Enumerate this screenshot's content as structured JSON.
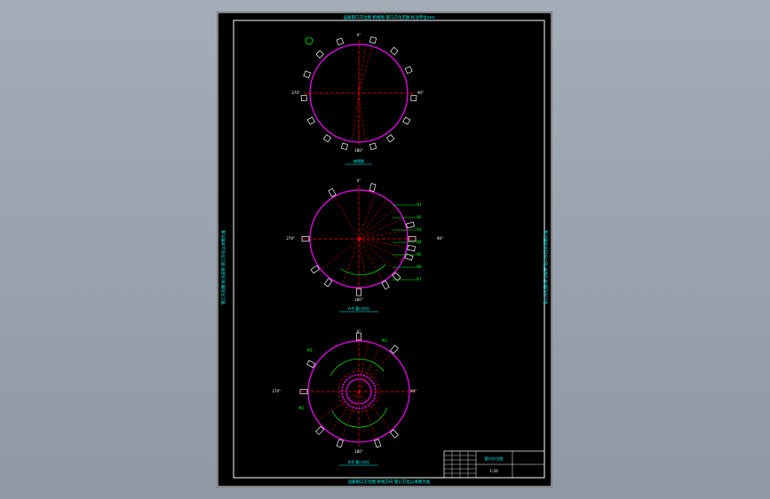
{
  "drawing": {
    "header_note": "设备管口方位图 俯视图 管口方位见图 标注单位mm",
    "footer_note": "设备管口方位图 俯视方向 管口方位以本图为准",
    "side_note_left": "管口方位图 标注说明 管口方位以本图为准",
    "side_note_right": "管口方位图 标注说明 管口方位以本图为准",
    "colors": {
      "background": "#000000",
      "border": "#ffffff",
      "vessel": "#ff00ff",
      "centerline": "#ff0000",
      "dimension": "#00ff00",
      "text": "#00ffff",
      "nozzle": "#ffffff"
    }
  },
  "views": [
    {
      "id": "view-top",
      "caption": "俯视图",
      "labels": {
        "top": "0°",
        "left": "270°",
        "right": "90°",
        "bottom": "180°"
      }
    },
    {
      "id": "view-middle",
      "caption": "A-A 管口方位",
      "labels": {
        "top": "0°",
        "left": "270°",
        "right": "90°",
        "bottom": "180°"
      },
      "callouts": [
        "N1",
        "N2",
        "N3",
        "N4",
        "N5",
        "N6",
        "N7"
      ]
    },
    {
      "id": "view-bottom",
      "caption": "B-B 管口方位",
      "labels": {
        "top": "0°",
        "left": "270°",
        "right": "90°",
        "bottom": "180°"
      },
      "callouts": [
        "M1",
        "M2",
        "M3"
      ]
    }
  ],
  "title_block": {
    "title": "管口方位图",
    "scale": "1:20"
  }
}
